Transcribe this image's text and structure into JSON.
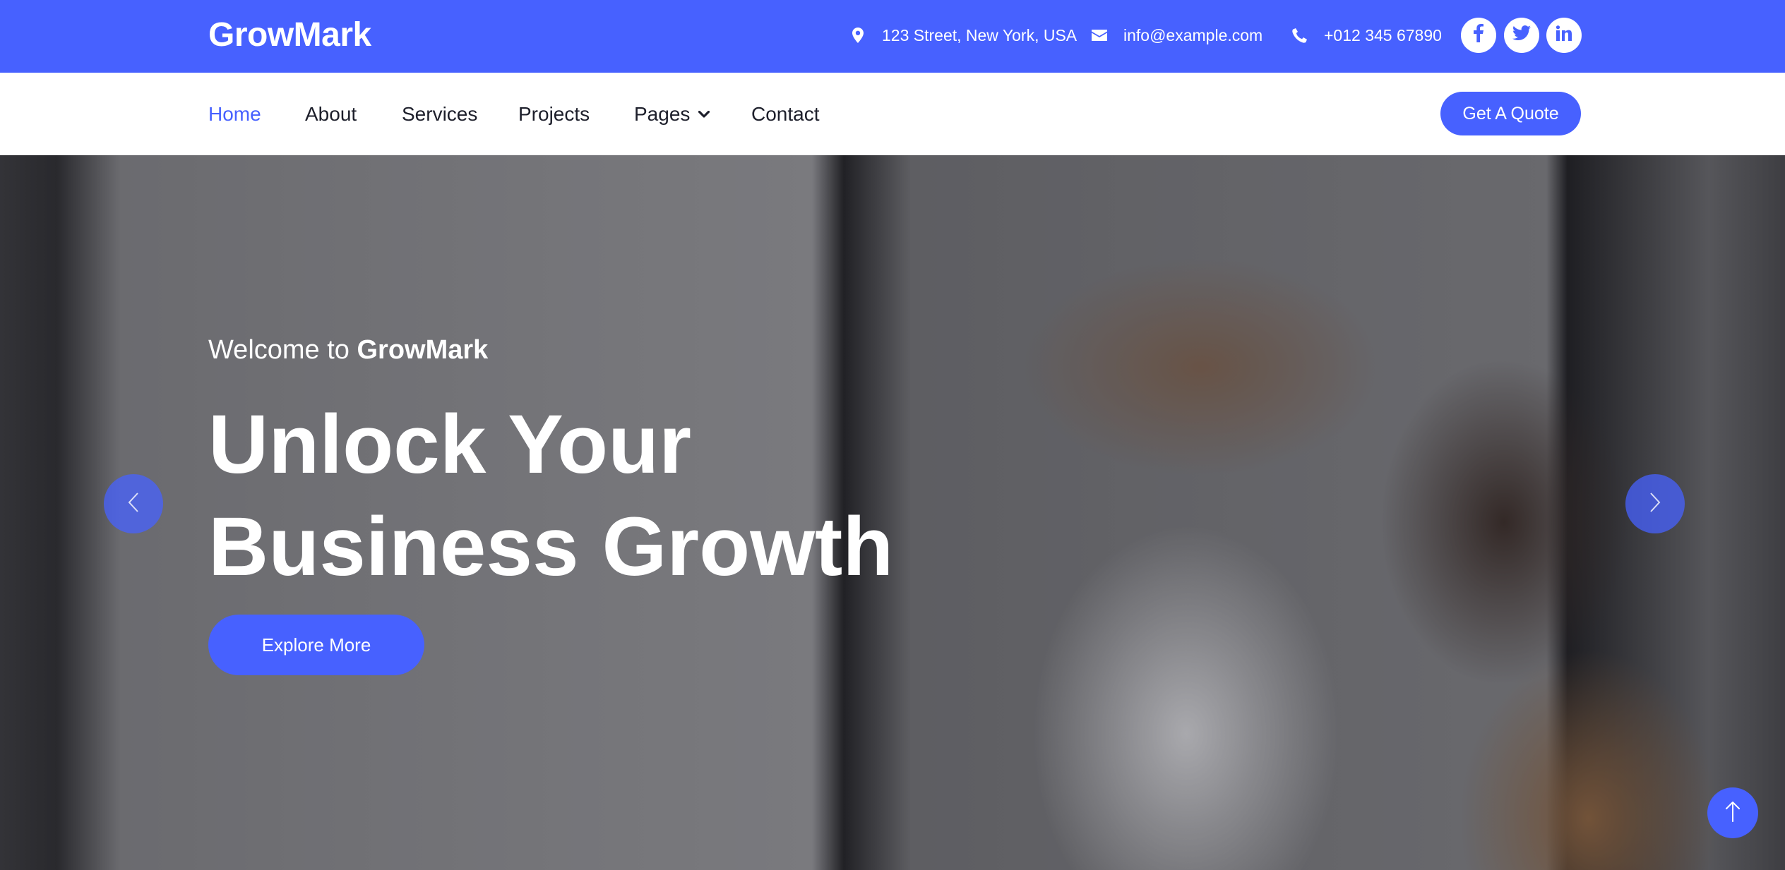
{
  "brand": {
    "name": "GrowMark"
  },
  "topbar": {
    "address": "123 Street, New York, USA",
    "email": "info@example.com",
    "phone": "+012 345 67890",
    "social": [
      {
        "icon": "facebook-icon",
        "glyph": "f"
      },
      {
        "icon": "twitter-icon",
        "glyph": "t"
      },
      {
        "icon": "linkedin-icon",
        "glyph": "in"
      }
    ]
  },
  "nav": {
    "items": [
      {
        "label": "Home",
        "active": true
      },
      {
        "label": "About"
      },
      {
        "label": "Services"
      },
      {
        "label": "Projects"
      },
      {
        "label": "Pages",
        "dropdown": true
      },
      {
        "label": "Contact"
      }
    ],
    "cta_label": "Get A Quote"
  },
  "hero": {
    "welcome_prefix": "Welcome to",
    "welcome_brand": "GrowMark",
    "headline_line1": "Unlock Your",
    "headline_line2": "Business Growth",
    "button_label": "Explore More"
  },
  "colors": {
    "accent": "#4761ff",
    "nav_text": "#1d1f2b",
    "white": "#ffffff"
  }
}
